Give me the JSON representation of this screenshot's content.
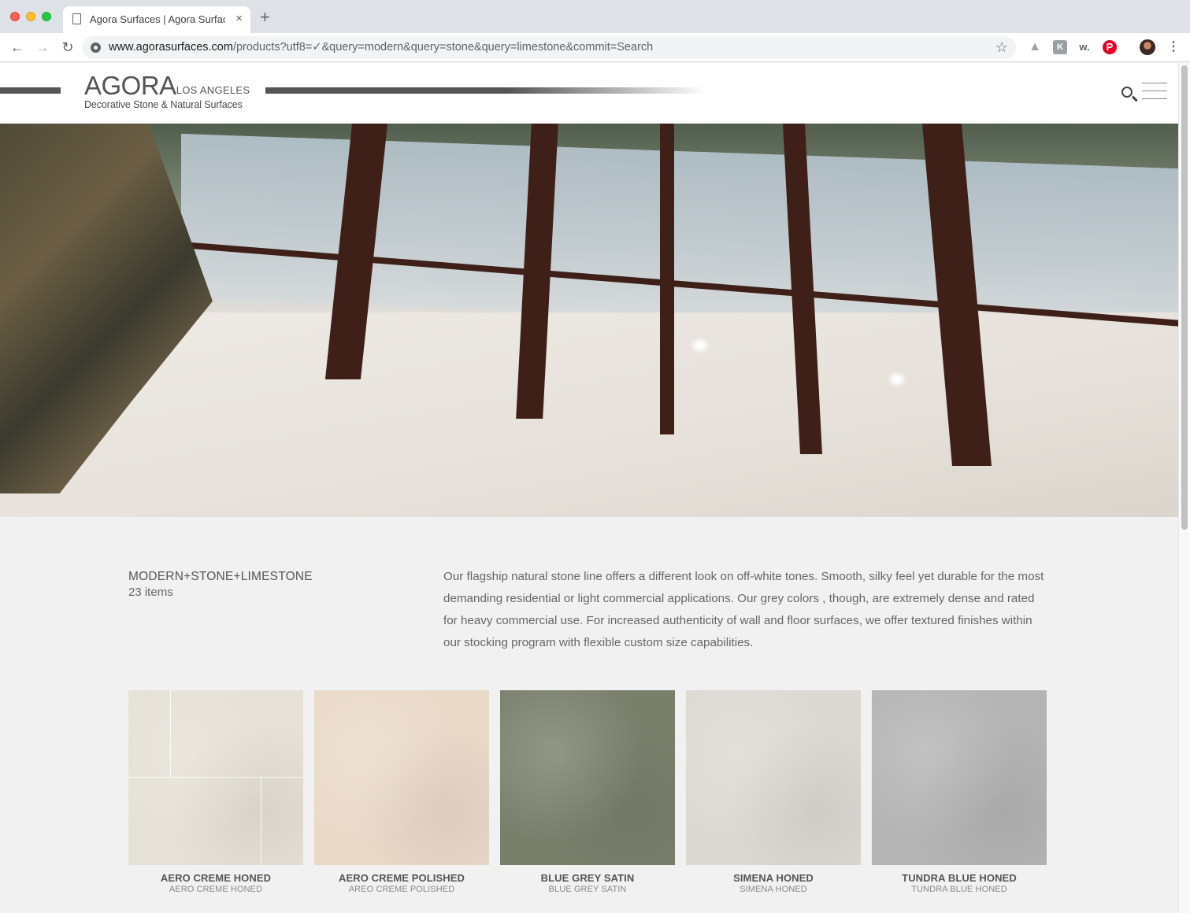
{
  "browser": {
    "tab_title": "Agora Surfaces | Agora Surfaces",
    "tab_close": "×",
    "new_tab": "+",
    "url_host": "www.agorasurfaces.com",
    "url_path": "/products?utf8=✓&query=modern&query=stone&query=limestone&commit=Search",
    "back": "←",
    "forward": "→",
    "reload": "↻",
    "star": "☆",
    "extensions": {
      "drive": "▲",
      "k": "K",
      "w": "w.",
      "pinterest": "P",
      "menu": "⋮"
    }
  },
  "header": {
    "brand": "AGORA",
    "city": "LOS ANGELES",
    "tagline": "Decorative Stone & Natural Surfaces"
  },
  "listing": {
    "category": "MODERN+STONE+LIMESTONE",
    "count": "23 items",
    "description": "Our flagship natural stone line offers a different look on off-white tones. Smooth, silky feel yet durable for the most demanding residential or light commercial applications. Our grey colors , though, are extremely dense and rated for heavy commercial use. For increased authenticity of wall and floor surfaces, we offer textured finishes within our stocking program with flexible custom size capabilities."
  },
  "products": [
    {
      "name": "AERO CREME HONED",
      "sub": "AERO CREME HONED",
      "color": "#e6e1d6"
    },
    {
      "name": "AERO CREME POLISHED",
      "sub": "AREO CREME POLISHED",
      "color": "#e9d9c9"
    },
    {
      "name": "BLUE GREY SATIN",
      "sub": "BLUE GREY SATIN",
      "color": "#7a7f6c"
    },
    {
      "name": "SIMENA HONED",
      "sub": "SIMENA HONED",
      "color": "#dcd8d2"
    },
    {
      "name": "TUNDRA BLUE HONED",
      "sub": "TUNDRA BLUE HONED",
      "color": "#b3b4b3"
    }
  ]
}
